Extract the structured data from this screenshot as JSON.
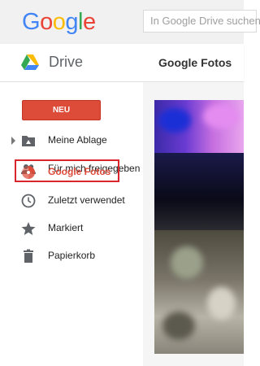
{
  "header": {
    "logo_letters": [
      {
        "char": "G",
        "color": "#4285f4"
      },
      {
        "char": "o",
        "color": "#ea4335"
      },
      {
        "char": "o",
        "color": "#fbbc05"
      },
      {
        "char": "g",
        "color": "#4285f4"
      },
      {
        "char": "l",
        "color": "#34a853"
      },
      {
        "char": "e",
        "color": "#ea4335"
      }
    ],
    "search_placeholder": "In Google Drive suchen"
  },
  "appbar": {
    "app_name": "Drive",
    "page_title": "Google Fotos"
  },
  "sidebar": {
    "new_button": "NEU",
    "items": [
      {
        "label": "Meine Ablage",
        "icon": "folder-drive-icon"
      },
      {
        "label": "Für mich freigegeben",
        "icon": "people-icon"
      },
      {
        "label": "Google Fotos",
        "icon": "google-photos-icon",
        "active": true
      },
      {
        "label": "Zuletzt verwendet",
        "icon": "clock-icon"
      },
      {
        "label": "Markiert",
        "icon": "star-icon"
      },
      {
        "label": "Papierkorb",
        "icon": "trash-icon"
      }
    ]
  },
  "colors": {
    "accent_red": "#dd4b39",
    "highlight_border": "#d9252c"
  }
}
